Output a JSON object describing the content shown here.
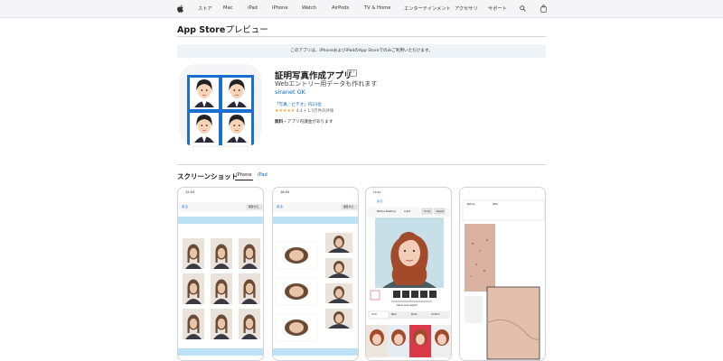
{
  "global_nav": {
    "items": [
      "ストア",
      "Mac",
      "iPad",
      "iPhone",
      "Watch",
      "AirPods",
      "TV & Home",
      "エンターテインメント",
      "アクセサリ",
      "サポート"
    ]
  },
  "subnav": {
    "brand": "App Store",
    "brand_suffix": "プレビュー"
  },
  "banner": {
    "text": "このアプリは、iPhoneおよびiPadのApp Storeでのみご利用いただけます。"
  },
  "app": {
    "title": "証明写真作成アプリ",
    "age_rating": "4+",
    "subtitle": "Webエントリー用データも作れます",
    "developer": "siranet GK",
    "rank": "「写真／ビデオ」内23位",
    "stars": "★★★★★",
    "rating_text": "4.4 • 1.5万件の評価",
    "price_label": "無料",
    "price_note": "・アプリ内課金があります"
  },
  "screenshots": {
    "title": "スクリーンショット",
    "tabs": [
      "iPhone",
      "iPad"
    ],
    "shot1": {
      "time": "15:54",
      "back": "戻る",
      "button": "保存する"
    },
    "shot2": {
      "time": "16:05",
      "back": "戻る",
      "button": "保存する"
    },
    "shot3": {
      "time": "15:52",
      "back": "戻る",
      "toolbar": [
        "Before Beating",
        "Light",
        "Undo",
        "Reset"
      ],
      "text": "Same size aspect",
      "bottom_buttons": [
        "Color",
        "Back",
        "Mode",
        "Confirm"
      ]
    },
    "shot4": {
      "labels": [
        "Before",
        "After"
      ]
    }
  },
  "colors": {
    "link": "#0066cc",
    "star": "#f5a623",
    "banner_bg": "#eef3f8",
    "icon_blue": "#1a6fd1"
  }
}
